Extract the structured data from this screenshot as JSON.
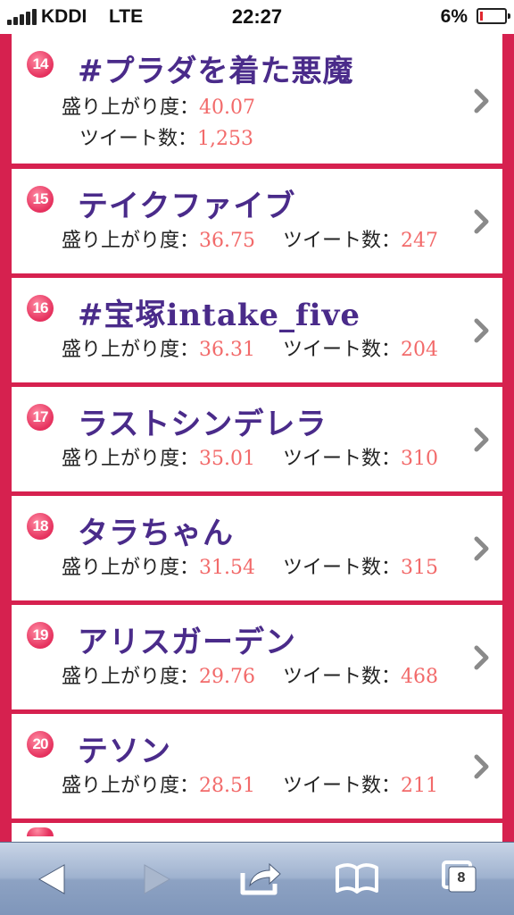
{
  "status_bar": {
    "carrier": "KDDI",
    "network": "LTE",
    "time": "22:27",
    "battery_percent": "6%",
    "battery_level": 0.06
  },
  "labels": {
    "excitement": "盛り上がり度：",
    "tweets": "ツイート数："
  },
  "items": [
    {
      "rank": "14",
      "title": "#プラダを着た悪魔",
      "excitement": "40.07",
      "tweets": "1,253"
    },
    {
      "rank": "15",
      "title": "テイクファイブ",
      "excitement": "36.75",
      "tweets": "247"
    },
    {
      "rank": "16",
      "title": "#宝塚intake_five",
      "excitement": "36.31",
      "tweets": "204"
    },
    {
      "rank": "17",
      "title": "ラストシンデレラ",
      "excitement": "35.01",
      "tweets": "310"
    },
    {
      "rank": "18",
      "title": "タラちゃん",
      "excitement": "31.54",
      "tweets": "315"
    },
    {
      "rank": "19",
      "title": "アリスガーデン",
      "excitement": "29.76",
      "tweets": "468"
    },
    {
      "rank": "20",
      "title": "テソン",
      "excitement": "28.51",
      "tweets": "211"
    }
  ],
  "toolbar": {
    "back_icon": "back-arrow-icon",
    "forward_icon": "forward-arrow-icon",
    "share_icon": "share-icon",
    "bookmarks_icon": "book-icon",
    "tabs_icon": "tabs-icon",
    "tabs_count": "8"
  },
  "colors": {
    "frame": "#d6214f",
    "title": "#4a2b8a",
    "value": "#f26a6a",
    "badge": "#e5305d"
  }
}
